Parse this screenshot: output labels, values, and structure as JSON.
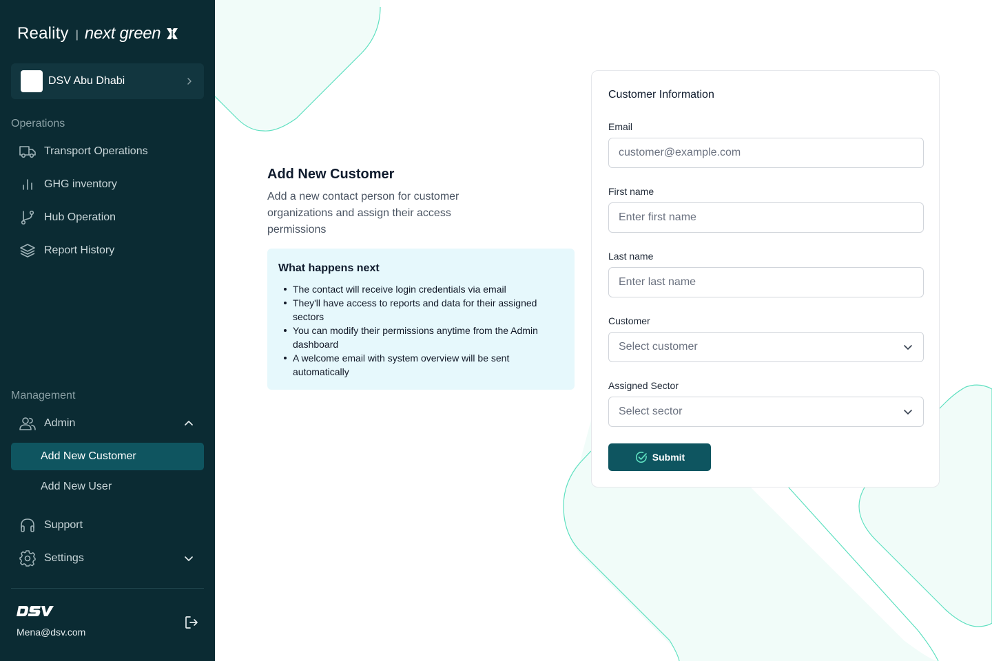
{
  "brand": {
    "reality": "Reality",
    "separator": "|",
    "next": "next green"
  },
  "org": {
    "name": "DSV Abu Dhabi"
  },
  "sidebar": {
    "operations_label": "Operations",
    "operations": [
      {
        "label": "Transport Operations",
        "icon": "truck-icon"
      },
      {
        "label": "GHG inventory",
        "icon": "bar-chart-icon"
      },
      {
        "label": "Hub Operation",
        "icon": "git-branch-icon"
      },
      {
        "label": "Report History",
        "icon": "layers-icon"
      }
    ],
    "management_label": "Management",
    "admin": {
      "label": "Admin",
      "icon": "users-icon",
      "expanded": true
    },
    "admin_items": [
      {
        "label": "Add New Customer",
        "active": true
      },
      {
        "label": "Add New User",
        "active": false
      }
    ],
    "support": {
      "label": "Support",
      "icon": "headset-icon"
    },
    "settings": {
      "label": "Settings",
      "icon": "gear-icon"
    }
  },
  "footer": {
    "logo": "DSV",
    "email": "Mena@dsv.com"
  },
  "intro": {
    "title": "Add New Customer",
    "description": "Add a new contact person for customer organizations and assign their access permissions"
  },
  "next_steps": {
    "title": "What happens next",
    "items": [
      "The contact will receive login credentials via email",
      "They'll have access to reports and data for their assigned sectors",
      "You can modify their permissions anytime from the Admin dashboard",
      "A welcome email with system overview will be sent automatically"
    ]
  },
  "form": {
    "title": "Customer Information",
    "email": {
      "label": "Email",
      "placeholder": "customer@example.com"
    },
    "first_name": {
      "label": "First name",
      "placeholder": "Enter first name"
    },
    "last_name": {
      "label": "Last name",
      "placeholder": "Enter last name"
    },
    "customer": {
      "label": "Customer",
      "placeholder": "Select customer"
    },
    "sector": {
      "label": "Assigned Sector",
      "placeholder": "Select sector"
    },
    "submit_label": "Submit"
  },
  "colors": {
    "sidebar_bg": "#0b2b33",
    "active_bg": "#0f5560",
    "accent": "#0e5560",
    "deco_fill": "#f1fcf9",
    "deco_stroke": "#5ee0c0",
    "info_bg": "#e6f8fc"
  }
}
